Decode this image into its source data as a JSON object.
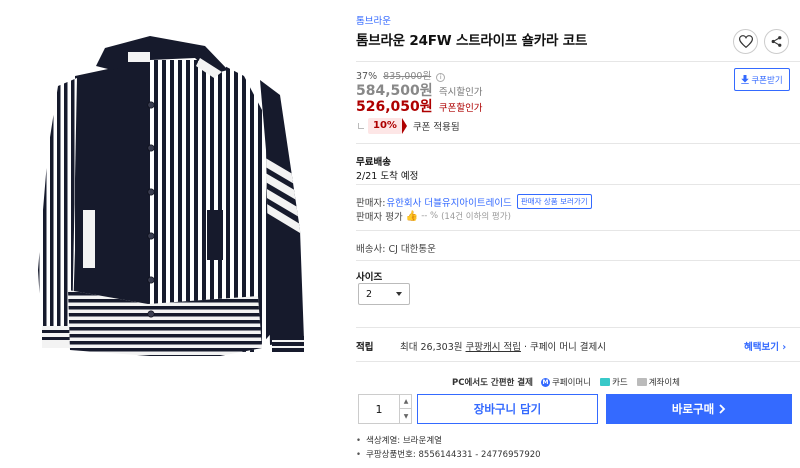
{
  "product": {
    "brand": "톰브라운",
    "title": "톰브라운 24FW 스트라이프 숄카라 코트"
  },
  "price": {
    "discount_rate": "37%",
    "original_price": "835,000원",
    "sale_price": "584,500원",
    "sale_label": "즉시할인가",
    "coupon_price": "526,050원",
    "coupon_label": "쿠폰할인가",
    "coupon_rate": "10%",
    "coupon_applied_text": "쿠폰 적용됨",
    "coupon_button_label": "쿠폰받기"
  },
  "delivery": {
    "title": "무료배송",
    "date": "2/21 도착 예정"
  },
  "seller": {
    "label": "판매자:",
    "name": "유한회사 더블유지아이트레이드",
    "button_label": "판매자 상품 보러가기",
    "rating_label": "판매자 평가",
    "rating_value": "-- %",
    "rating_count": "(14건 이하의 평가)"
  },
  "shipper": "배송사: CJ 대한통운",
  "size": {
    "label": "사이즈",
    "selected": "2"
  },
  "reward": {
    "label": "적립",
    "text_prefix": "최대 26,303원",
    "text_link": "쿠팡캐시 적립",
    "text_suffix": "· 쿠페이 머니 결제시",
    "benefit_link": "혜택보기"
  },
  "payment": {
    "heading": "PC에서도 간편한 결제",
    "methods": [
      "쿠페이머니",
      "카드",
      "계좌이체"
    ],
    "coupay_icon_text": "M"
  },
  "purchase": {
    "quantity": "1",
    "cart_label": "장바구니 담기",
    "buy_label": "바로구매"
  },
  "details": [
    "색상계열: 브라운계열",
    "쿠팡상품번호: 8556144331 - 24776957920"
  ],
  "icons": {
    "like": "heart-icon",
    "share": "share-icon",
    "coupon": "download-icon",
    "thumb": "thumbs-up-icon",
    "chevron": "chevron-right-icon"
  },
  "colors": {
    "accent": "#346aff",
    "coupon_red": "#ae0000",
    "garment_navy": "#161a2c"
  }
}
